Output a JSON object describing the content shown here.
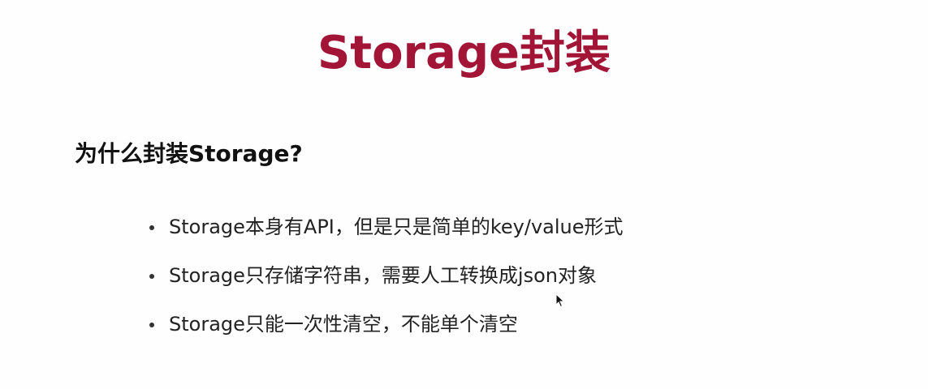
{
  "slide": {
    "title": "Storage封装",
    "subtitle": "为什么封装Storage?",
    "bullets": [
      "Storage本身有API，但是只是简单的key/value形式",
      "Storage只存储字符串，需要人工转换成json对象",
      "Storage只能一次性清空，不能单个清空"
    ]
  },
  "colors": {
    "title": "#a31536",
    "text": "#222222"
  },
  "icons": {
    "cursor": "mouse-pointer-icon"
  }
}
